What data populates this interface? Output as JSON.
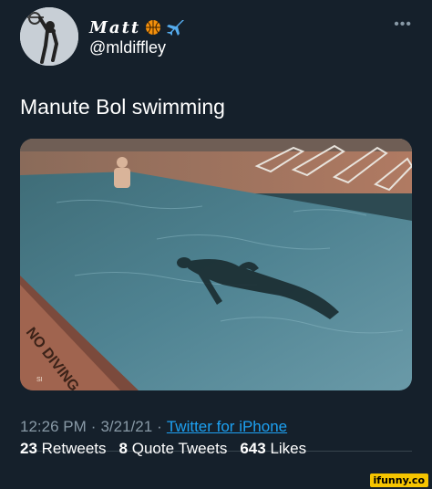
{
  "author": {
    "display_name": "Matt",
    "handle": "@mldiffley",
    "avatar_icon": "basketball-player-avatar-icon",
    "name_emojis": [
      "basketball-icon",
      "airplane-icon"
    ]
  },
  "tweet": {
    "text": "Manute Bol swimming",
    "media_alt": "",
    "pool_sign_text": "NO DIVING",
    "pool_sign_small": "SI"
  },
  "metadata": {
    "time": "12:26 PM",
    "separator": "·",
    "date": "3/21/21",
    "source": "Twitter for iPhone"
  },
  "stats": {
    "retweets_count": "23",
    "retweets_label": "Retweets",
    "quote_count": "8",
    "quote_label": "Quote Tweets",
    "likes_count": "643",
    "likes_label": "Likes"
  },
  "watermark": "ifunny.co",
  "colors": {
    "background": "#15202b",
    "secondary_text": "#8899a6",
    "link": "#1da1f2",
    "divider": "#38444d"
  }
}
